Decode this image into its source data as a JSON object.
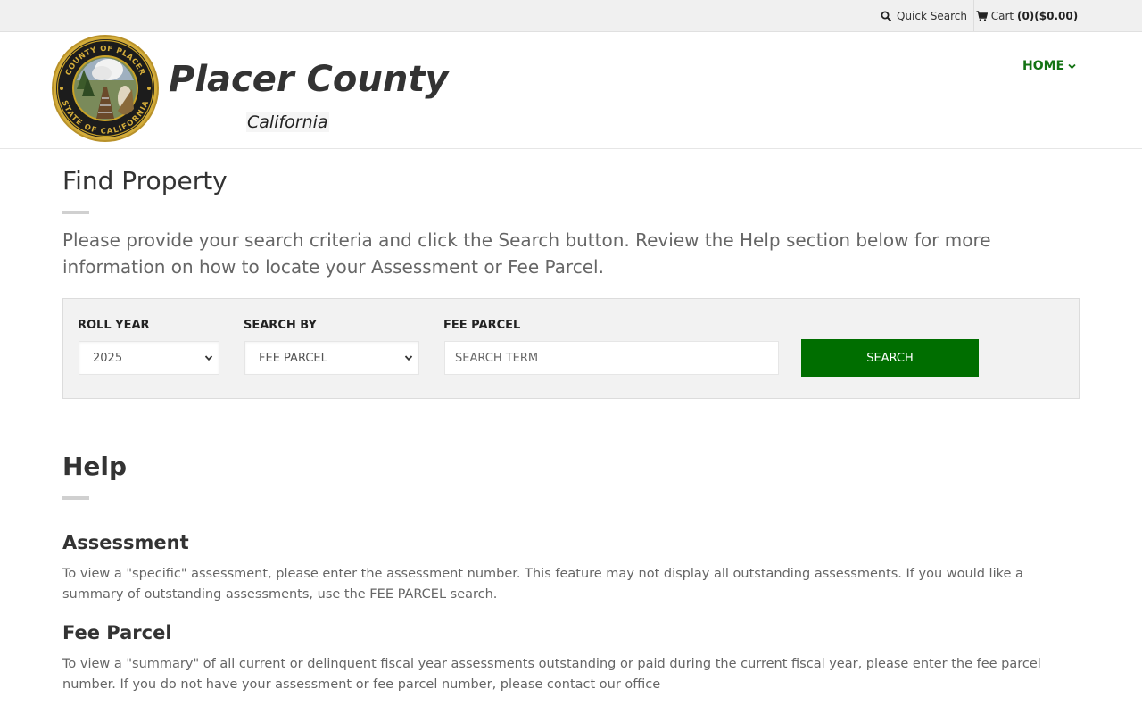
{
  "topbar": {
    "quick_search_label": "Quick Search",
    "cart_label": "Cart",
    "cart_summary": "(0)($0.00)"
  },
  "header": {
    "brand_title": "Placer County",
    "brand_subtitle": "California",
    "seal_text_top": "COUNTY OF PLACER",
    "seal_text_bottom": "STATE OF CALIFORNIA",
    "nav_home_label": "HOME"
  },
  "main": {
    "title": "Find Property",
    "intro": "Please provide your search criteria and click the Search button. Review the Help section below for more information on how to locate your Assessment or Fee Parcel."
  },
  "search": {
    "roll_year_label": "ROLL YEAR",
    "roll_year_value": "2025",
    "search_by_label": "SEARCH BY",
    "search_by_value": "FEE PARCEL",
    "term_label": "FEE PARCEL",
    "term_placeholder": "SEARCH TERM",
    "button_label": "SEARCH"
  },
  "help": {
    "title": "Help",
    "sections": [
      {
        "heading": "Assessment",
        "text": "To view a \"specific\" assessment, please enter the assessment number. This feature may not display all outstanding assessments. If you would like a summary of outstanding assessments, use the FEE PARCEL search."
      },
      {
        "heading": "Fee Parcel",
        "text": "To view a \"summary\" of all current or delinquent fiscal year assessments outstanding or paid during the current fiscal year, please enter the fee parcel number. If you do not have your assessment or fee parcel number, please contact our office"
      }
    ]
  },
  "colors": {
    "accent_green": "#006e00",
    "nav_green": "#137313",
    "seal_gold": "#c9a227"
  },
  "icons": {
    "quick_search": "search-icon",
    "cart": "shopping-cart-icon",
    "home_chevron": "chevron-down-icon",
    "select_caret": "chevron-down-icon"
  }
}
